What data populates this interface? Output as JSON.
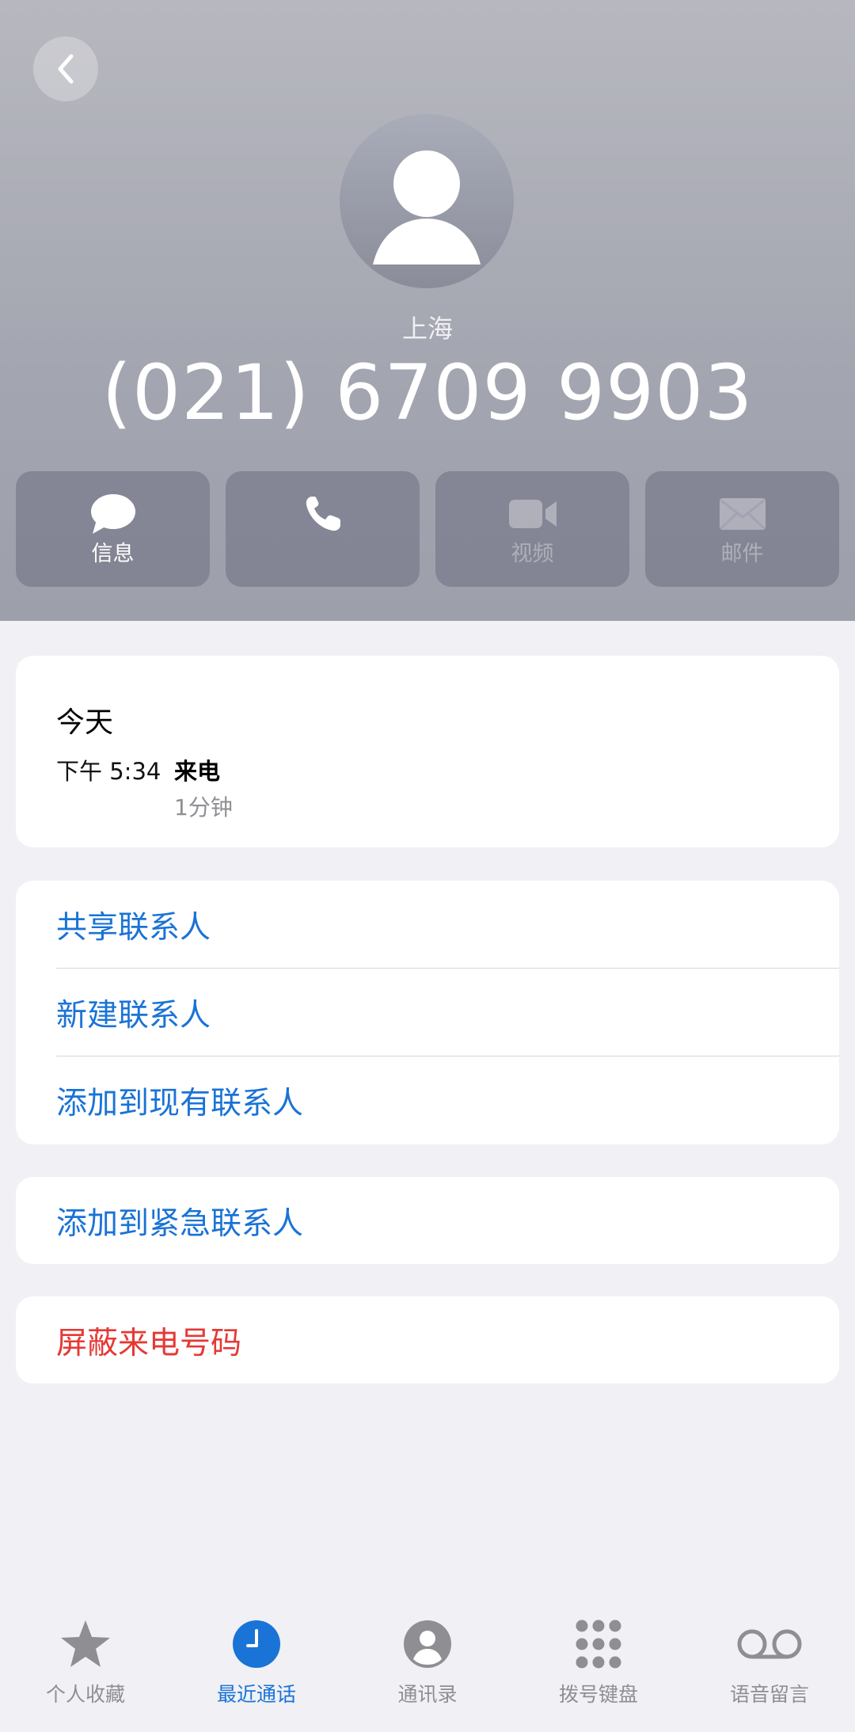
{
  "header": {
    "location": "上海",
    "phone_number": "(021) 6709 9903"
  },
  "actions": [
    {
      "label": "信息",
      "icon": "message-icon",
      "enabled": true
    },
    {
      "label": "",
      "icon": "phone-icon",
      "enabled": true
    },
    {
      "label": "视频",
      "icon": "video-icon",
      "enabled": false
    },
    {
      "label": "邮件",
      "icon": "mail-icon",
      "enabled": false
    }
  ],
  "recent": {
    "day": "今天",
    "time": "下午 5:34",
    "type": "来电",
    "duration": "1分钟"
  },
  "contact_options": {
    "share": "共享联系人",
    "new": "新建联系人",
    "add_existing": "添加到现有联系人"
  },
  "emergency": {
    "add": "添加到紧急联系人"
  },
  "block": {
    "label": "屏蔽来电号码"
  },
  "tabbar": {
    "items": [
      {
        "label": "个人收藏",
        "icon": "star-icon"
      },
      {
        "label": "最近通话",
        "icon": "clock-icon",
        "active": true
      },
      {
        "label": "通讯录",
        "icon": "contact-icon"
      },
      {
        "label": "拨号键盘",
        "icon": "keypad-icon"
      },
      {
        "label": "语音留言",
        "icon": "voicemail-icon"
      }
    ]
  },
  "colors": {
    "accent": "#1a73d6",
    "danger": "#e53935",
    "inactive": "#8e8e93"
  }
}
